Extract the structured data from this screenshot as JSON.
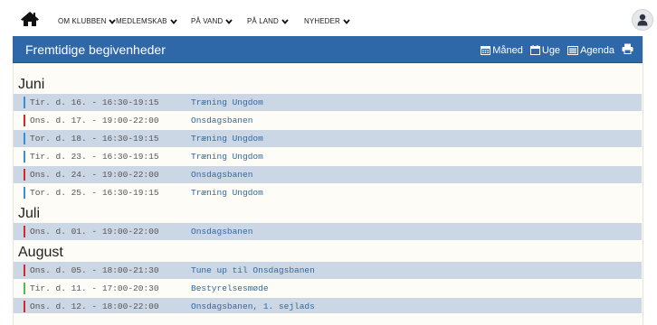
{
  "nav": {
    "items": [
      {
        "label": "OM KLUBBEN"
      },
      {
        "label": "MEDLEMSKAB"
      },
      {
        "label": "PÅ VAND"
      },
      {
        "label": "PÅ LAND"
      },
      {
        "label": "NYHEDER"
      }
    ]
  },
  "header": {
    "title": "Fremtidige begivenheder",
    "views": [
      {
        "label": "Måned",
        "icon": "calendar-month-icon"
      },
      {
        "label": "Uge",
        "icon": "calendar-week-icon"
      },
      {
        "label": "Agenda",
        "icon": "agenda-list-icon"
      }
    ],
    "print_icon": "print-icon"
  },
  "colors": {
    "brand": "#2f68a8",
    "row_shade": "#ccd7e5",
    "marker_blue": "#3b8fd9",
    "marker_red": "#d62828",
    "marker_green": "#4cc04a"
  },
  "months": [
    {
      "name": "Juni",
      "events": [
        {
          "date": "Tir. d. 16. - 16:30-19:15",
          "title": "Træning Ungdom",
          "color": "#3b8fd9"
        },
        {
          "date": "Ons. d. 17. - 19:00-22:00",
          "title": "Onsdagsbanen",
          "color": "#d62828"
        },
        {
          "date": "Tor. d. 18. - 16:30-19:15",
          "title": "Træning Ungdom",
          "color": "#3b8fd9"
        },
        {
          "date": "Tir. d. 23. - 16:30-19:15",
          "title": "Træning Ungdom",
          "color": "#3b8fd9"
        },
        {
          "date": "Ons. d. 24. - 19:00-22:00",
          "title": "Onsdagsbanen",
          "color": "#d62828"
        },
        {
          "date": "Tor. d. 25. - 16:30-19:15",
          "title": "Træning Ungdom",
          "color": "#3b8fd9"
        }
      ]
    },
    {
      "name": "Juli",
      "events": [
        {
          "date": "Ons. d. 01. - 19:00-22:00",
          "title": "Onsdagsbanen",
          "color": "#d62828"
        }
      ]
    },
    {
      "name": "August",
      "events": [
        {
          "date": "Ons. d. 05. - 18:00-21:30",
          "title": "Tune up til Onsdagsbanen",
          "color": "#d62828"
        },
        {
          "date": "Tir. d. 11. - 17:00-20:30",
          "title": "Bestyrelsesmøde",
          "color": "#4cc04a"
        },
        {
          "date": "Ons. d. 12. - 18:00-22:00",
          "title": "Onsdagsbanen, 1. sejlads",
          "color": "#d62828"
        }
      ]
    }
  ]
}
